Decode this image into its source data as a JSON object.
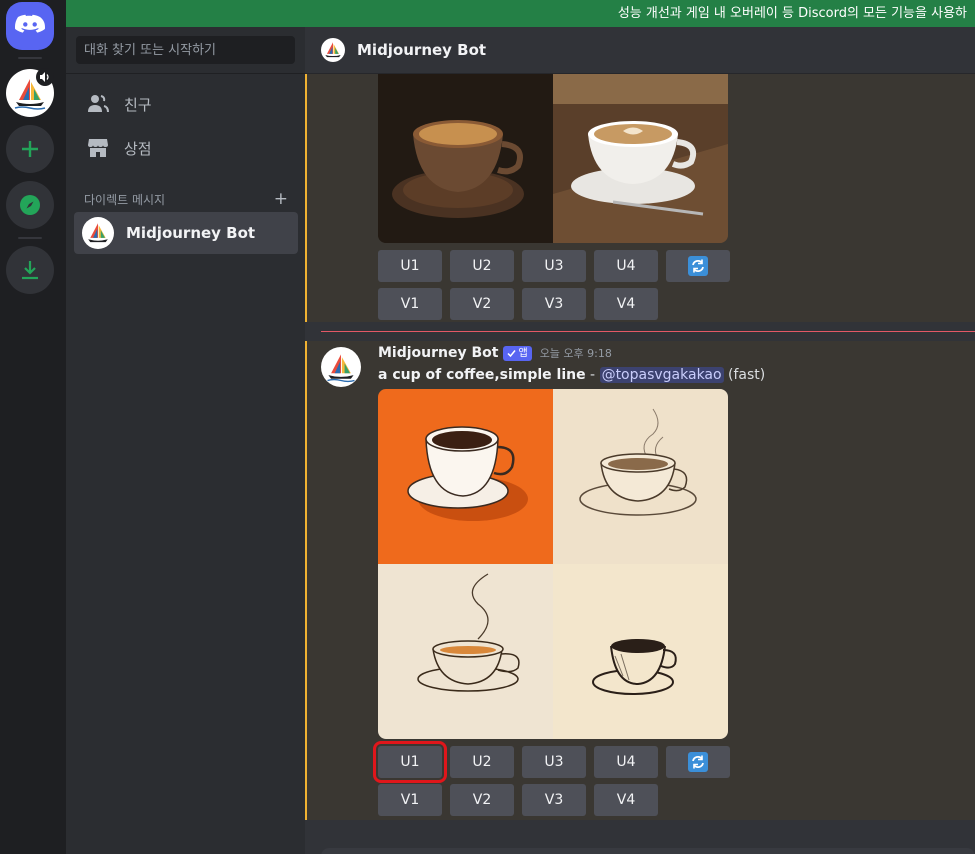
{
  "banner": {
    "text": "성능 개선과 게임 내 오버레이 등 Discord의 모든 기능을 사용하"
  },
  "guild_rail": {
    "items": [
      "discord-home",
      "midjourney-server",
      "add-server",
      "explore",
      "download"
    ]
  },
  "sidebar": {
    "search_placeholder": "대화 찾기 또는 시작하기",
    "nav": [
      {
        "label": "친구",
        "icon": "friends-icon"
      },
      {
        "label": "상점",
        "icon": "shop-icon"
      }
    ],
    "dm_header": "다이렉트 메시지",
    "dm_add": "+",
    "dms": [
      {
        "name": "Midjourney Bot"
      }
    ]
  },
  "chat": {
    "channel_name": "Midjourney Bot",
    "message": {
      "author": "Midjourney Bot",
      "badge": "앱",
      "timestamp": "오늘 오후 9:18",
      "prompt": "a cup of coffee,simple line",
      "separator": " - ",
      "mention": "@topasvgakakao",
      "mode": " (fast)"
    },
    "buttons": {
      "upscale": [
        "U1",
        "U2",
        "U3",
        "U4"
      ],
      "variation": [
        "V1",
        "V2",
        "V3",
        "V4"
      ],
      "reroll_icon": "refresh-icon"
    },
    "highlighted_button": "U1"
  },
  "colors": {
    "blurple": "#5865f2",
    "highlight": "#e0161b",
    "banner": "#248046",
    "message_accent": "#f0b232"
  }
}
